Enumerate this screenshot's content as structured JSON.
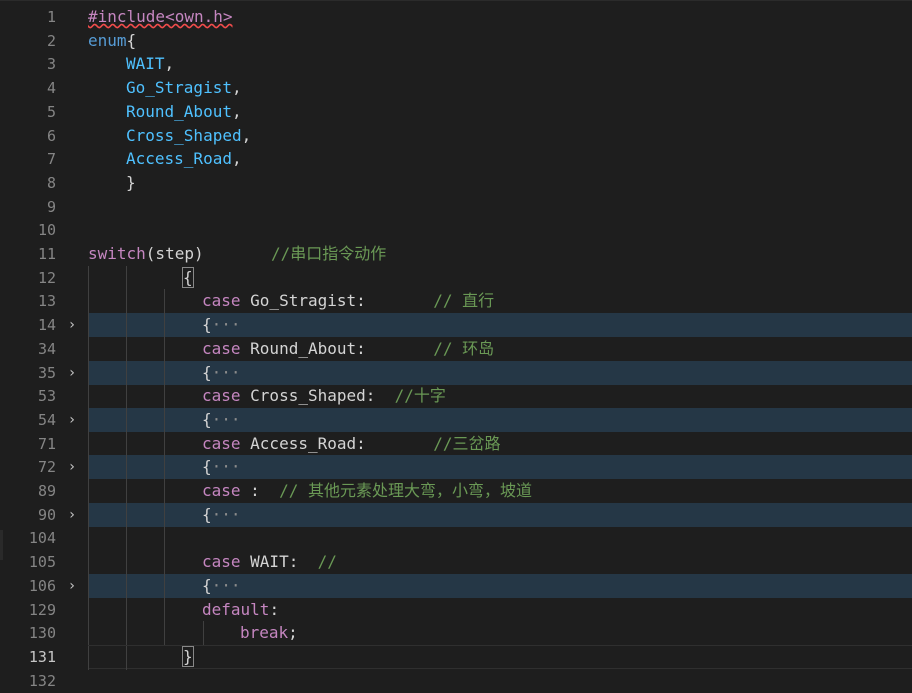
{
  "editor": {
    "lines": [
      {
        "num": "1",
        "fold": "",
        "folded": false,
        "current": false,
        "guides": 0,
        "indent": 0,
        "tokens": [
          {
            "t": "#include<own.h>",
            "c": "pre squig"
          }
        ]
      },
      {
        "num": "2",
        "fold": "",
        "folded": false,
        "current": false,
        "guides": 0,
        "indent": 0,
        "tokens": [
          {
            "t": "enum",
            "c": "kw"
          },
          {
            "t": "{",
            "c": ""
          }
        ]
      },
      {
        "num": "3",
        "fold": "",
        "folded": false,
        "current": false,
        "guides": 0,
        "indent": 4,
        "tokens": [
          {
            "t": "WAIT",
            "c": "enumc"
          },
          {
            "t": ",",
            "c": ""
          }
        ]
      },
      {
        "num": "4",
        "fold": "",
        "folded": false,
        "current": false,
        "guides": 0,
        "indent": 4,
        "tokens": [
          {
            "t": "Go_Stragist",
            "c": "enumc"
          },
          {
            "t": ",",
            "c": ""
          }
        ]
      },
      {
        "num": "5",
        "fold": "",
        "folded": false,
        "current": false,
        "guides": 0,
        "indent": 4,
        "tokens": [
          {
            "t": "Round_About",
            "c": "enumc"
          },
          {
            "t": ",",
            "c": ""
          }
        ]
      },
      {
        "num": "6",
        "fold": "",
        "folded": false,
        "current": false,
        "guides": 0,
        "indent": 4,
        "tokens": [
          {
            "t": "Cross_Shaped",
            "c": "enumc"
          },
          {
            "t": ",",
            "c": ""
          }
        ]
      },
      {
        "num": "7",
        "fold": "",
        "folded": false,
        "current": false,
        "guides": 0,
        "indent": 4,
        "tokens": [
          {
            "t": "Access_Road",
            "c": "enumc"
          },
          {
            "t": ",",
            "c": ""
          }
        ]
      },
      {
        "num": "8",
        "fold": "",
        "folded": false,
        "current": false,
        "guides": 0,
        "indent": 4,
        "tokens": [
          {
            "t": "}",
            "c": ""
          }
        ]
      },
      {
        "num": "9",
        "fold": "",
        "folded": false,
        "current": false,
        "guides": 0,
        "indent": 0,
        "tokens": []
      },
      {
        "num": "10",
        "fold": "",
        "folded": false,
        "current": false,
        "guides": 0,
        "indent": 0,
        "tokens": []
      },
      {
        "num": "11",
        "fold": "",
        "folded": false,
        "current": false,
        "guides": 0,
        "indent": 0,
        "tokens": [
          {
            "t": "switch",
            "c": "ctl"
          },
          {
            "t": "(step)       ",
            "c": ""
          },
          {
            "t": "//串口指令动作",
            "c": "cmt"
          }
        ]
      },
      {
        "num": "12",
        "fold": "",
        "folded": false,
        "current": false,
        "guides": 2,
        "indent": 10,
        "tokens": [
          {
            "t": "{",
            "c": "bracket-hl"
          }
        ]
      },
      {
        "num": "13",
        "fold": "",
        "folded": false,
        "current": false,
        "guides": 3,
        "indent": 12,
        "tokens": [
          {
            "t": "case",
            "c": "ctl"
          },
          {
            "t": " Go_Stragist:       ",
            "c": ""
          },
          {
            "t": "// 直行",
            "c": "cmt"
          }
        ]
      },
      {
        "num": "14",
        "fold": "›",
        "folded": true,
        "current": false,
        "guides": 3,
        "indent": 12,
        "tokens": [
          {
            "t": "{",
            "c": ""
          },
          {
            "t": "···",
            "c": "ell"
          }
        ]
      },
      {
        "num": "34",
        "fold": "",
        "folded": false,
        "current": false,
        "guides": 3,
        "indent": 12,
        "tokens": [
          {
            "t": "case",
            "c": "ctl"
          },
          {
            "t": " Round_About:       ",
            "c": ""
          },
          {
            "t": "// 环岛",
            "c": "cmt"
          }
        ]
      },
      {
        "num": "35",
        "fold": "›",
        "folded": true,
        "current": false,
        "guides": 3,
        "indent": 12,
        "tokens": [
          {
            "t": "{",
            "c": ""
          },
          {
            "t": "···",
            "c": "ell"
          }
        ]
      },
      {
        "num": "53",
        "fold": "",
        "folded": false,
        "current": false,
        "guides": 3,
        "indent": 12,
        "tokens": [
          {
            "t": "case",
            "c": "ctl"
          },
          {
            "t": " Cross_Shaped:  ",
            "c": ""
          },
          {
            "t": "//十字",
            "c": "cmt"
          }
        ]
      },
      {
        "num": "54",
        "fold": "›",
        "folded": true,
        "current": false,
        "guides": 3,
        "indent": 12,
        "tokens": [
          {
            "t": "{",
            "c": ""
          },
          {
            "t": "···",
            "c": "ell"
          }
        ]
      },
      {
        "num": "71",
        "fold": "",
        "folded": false,
        "current": false,
        "guides": 3,
        "indent": 12,
        "tokens": [
          {
            "t": "case",
            "c": "ctl"
          },
          {
            "t": " Access_Road:       ",
            "c": ""
          },
          {
            "t": "//三岔路",
            "c": "cmt"
          }
        ]
      },
      {
        "num": "72",
        "fold": "›",
        "folded": true,
        "current": false,
        "guides": 3,
        "indent": 12,
        "tokens": [
          {
            "t": "{",
            "c": ""
          },
          {
            "t": "···",
            "c": "ell"
          }
        ]
      },
      {
        "num": "89",
        "fold": "",
        "folded": false,
        "current": false,
        "guides": 3,
        "indent": 12,
        "tokens": [
          {
            "t": "case",
            "c": "ctl"
          },
          {
            "t": " :  ",
            "c": ""
          },
          {
            "t": "// 其他元素处理大弯，小弯，坡道",
            "c": "cmt"
          }
        ]
      },
      {
        "num": "90",
        "fold": "›",
        "folded": true,
        "current": false,
        "guides": 3,
        "indent": 12,
        "tokens": [
          {
            "t": "{",
            "c": ""
          },
          {
            "t": "···",
            "c": "ell"
          }
        ]
      },
      {
        "num": "104",
        "fold": "",
        "folded": false,
        "current": false,
        "guides": 3,
        "indent": 0,
        "tokens": []
      },
      {
        "num": "105",
        "fold": "",
        "folded": false,
        "current": false,
        "guides": 3,
        "indent": 12,
        "tokens": [
          {
            "t": "case",
            "c": "ctl"
          },
          {
            "t": " WAIT:  ",
            "c": ""
          },
          {
            "t": "//",
            "c": "cmt"
          }
        ]
      },
      {
        "num": "106",
        "fold": "›",
        "folded": true,
        "current": false,
        "guides": 3,
        "indent": 12,
        "tokens": [
          {
            "t": "{",
            "c": ""
          },
          {
            "t": "···",
            "c": "ell"
          }
        ]
      },
      {
        "num": "129",
        "fold": "",
        "folded": false,
        "current": false,
        "guides": 3,
        "indent": 12,
        "tokens": [
          {
            "t": "default",
            "c": "ctl"
          },
          {
            "t": ":",
            "c": ""
          }
        ]
      },
      {
        "num": "130",
        "fold": "",
        "folded": false,
        "current": false,
        "guides": 4,
        "indent": 16,
        "tokens": [
          {
            "t": "break",
            "c": "ctl"
          },
          {
            "t": ";",
            "c": ""
          }
        ]
      },
      {
        "num": "131",
        "fold": "",
        "folded": false,
        "current": true,
        "guides": 2,
        "indent": 10,
        "tokens": [
          {
            "t": "}",
            "c": "bracket-hl"
          }
        ]
      },
      {
        "num": "132",
        "fold": "",
        "folded": false,
        "current": false,
        "guides": 0,
        "indent": 0,
        "tokens": []
      }
    ]
  },
  "colors": {
    "background": "#1e1e1e",
    "folded_line": "#253746",
    "keyword": "#569cd6",
    "control": "#c586c0",
    "enum_member": "#4fc1ff",
    "comment": "#6a9955",
    "text": "#d4d4d4",
    "line_number": "#858585"
  },
  "icons": {
    "fold": "chevron-right-icon"
  }
}
